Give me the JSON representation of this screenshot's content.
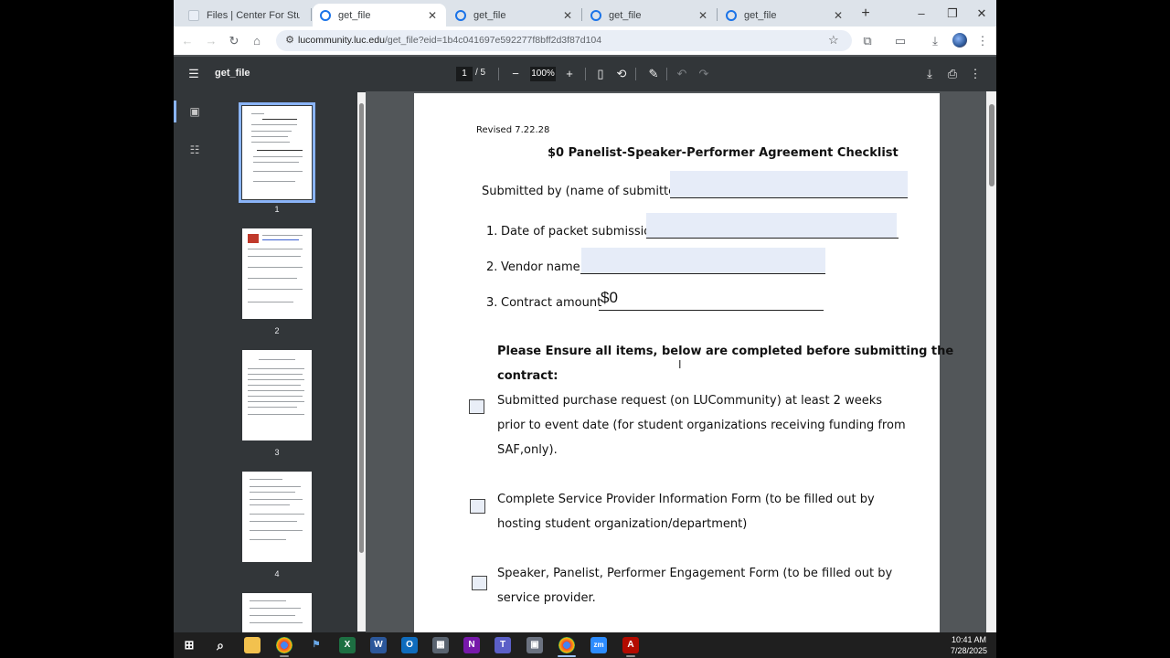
{
  "browser": {
    "tabs": [
      {
        "title": "Files | Center For Student",
        "active": false
      },
      {
        "title": "get_file",
        "active": true
      },
      {
        "title": "get_file",
        "active": false
      },
      {
        "title": "get_file",
        "active": false
      },
      {
        "title": "get_file",
        "active": false
      }
    ],
    "url_host": "lucommunity.luc.edu",
    "url_path": "/get_file?eid=1b4c041697e592277f8bff2d3f87d104"
  },
  "pdf": {
    "title": "get_file",
    "current_page": "1",
    "total_pages": "/  5",
    "zoom": "100%",
    "thumbnails": [
      "1",
      "2",
      "3",
      "4"
    ]
  },
  "document": {
    "revised": "Revised 7.22.28",
    "heading": "$0 Panelist-Speaker-Performer Agreement Checklist",
    "submitted_by": "Submitted by (name of submitter)",
    "items": [
      {
        "num": "1.",
        "label": "Date of packet submission"
      },
      {
        "num": "2.",
        "label": "Vendor name"
      },
      {
        "num": "3.",
        "label": "Contract amount"
      }
    ],
    "contract_amount_value": "$0",
    "instruction_line1": "Please Ensure all items, below are completed before submitting the",
    "instruction_line2": "contract:",
    "checklist": [
      {
        "lines": [
          "Submitted purchase request (on LUCommunity) at least 2 weeks",
          "prior to event date (for student organizations receiving funding from",
          "SAF,only)."
        ]
      },
      {
        "lines": [
          "Complete Service Provider Information Form (to be filled out by",
          "hosting student organization/department)"
        ]
      },
      {
        "lines": [
          "Speaker, Panelist, Performer Engagement Form (to be filled out by",
          "service provider."
        ]
      }
    ]
  },
  "taskbar": {
    "time": "10:41 AM",
    "date": "7/28/2025"
  }
}
